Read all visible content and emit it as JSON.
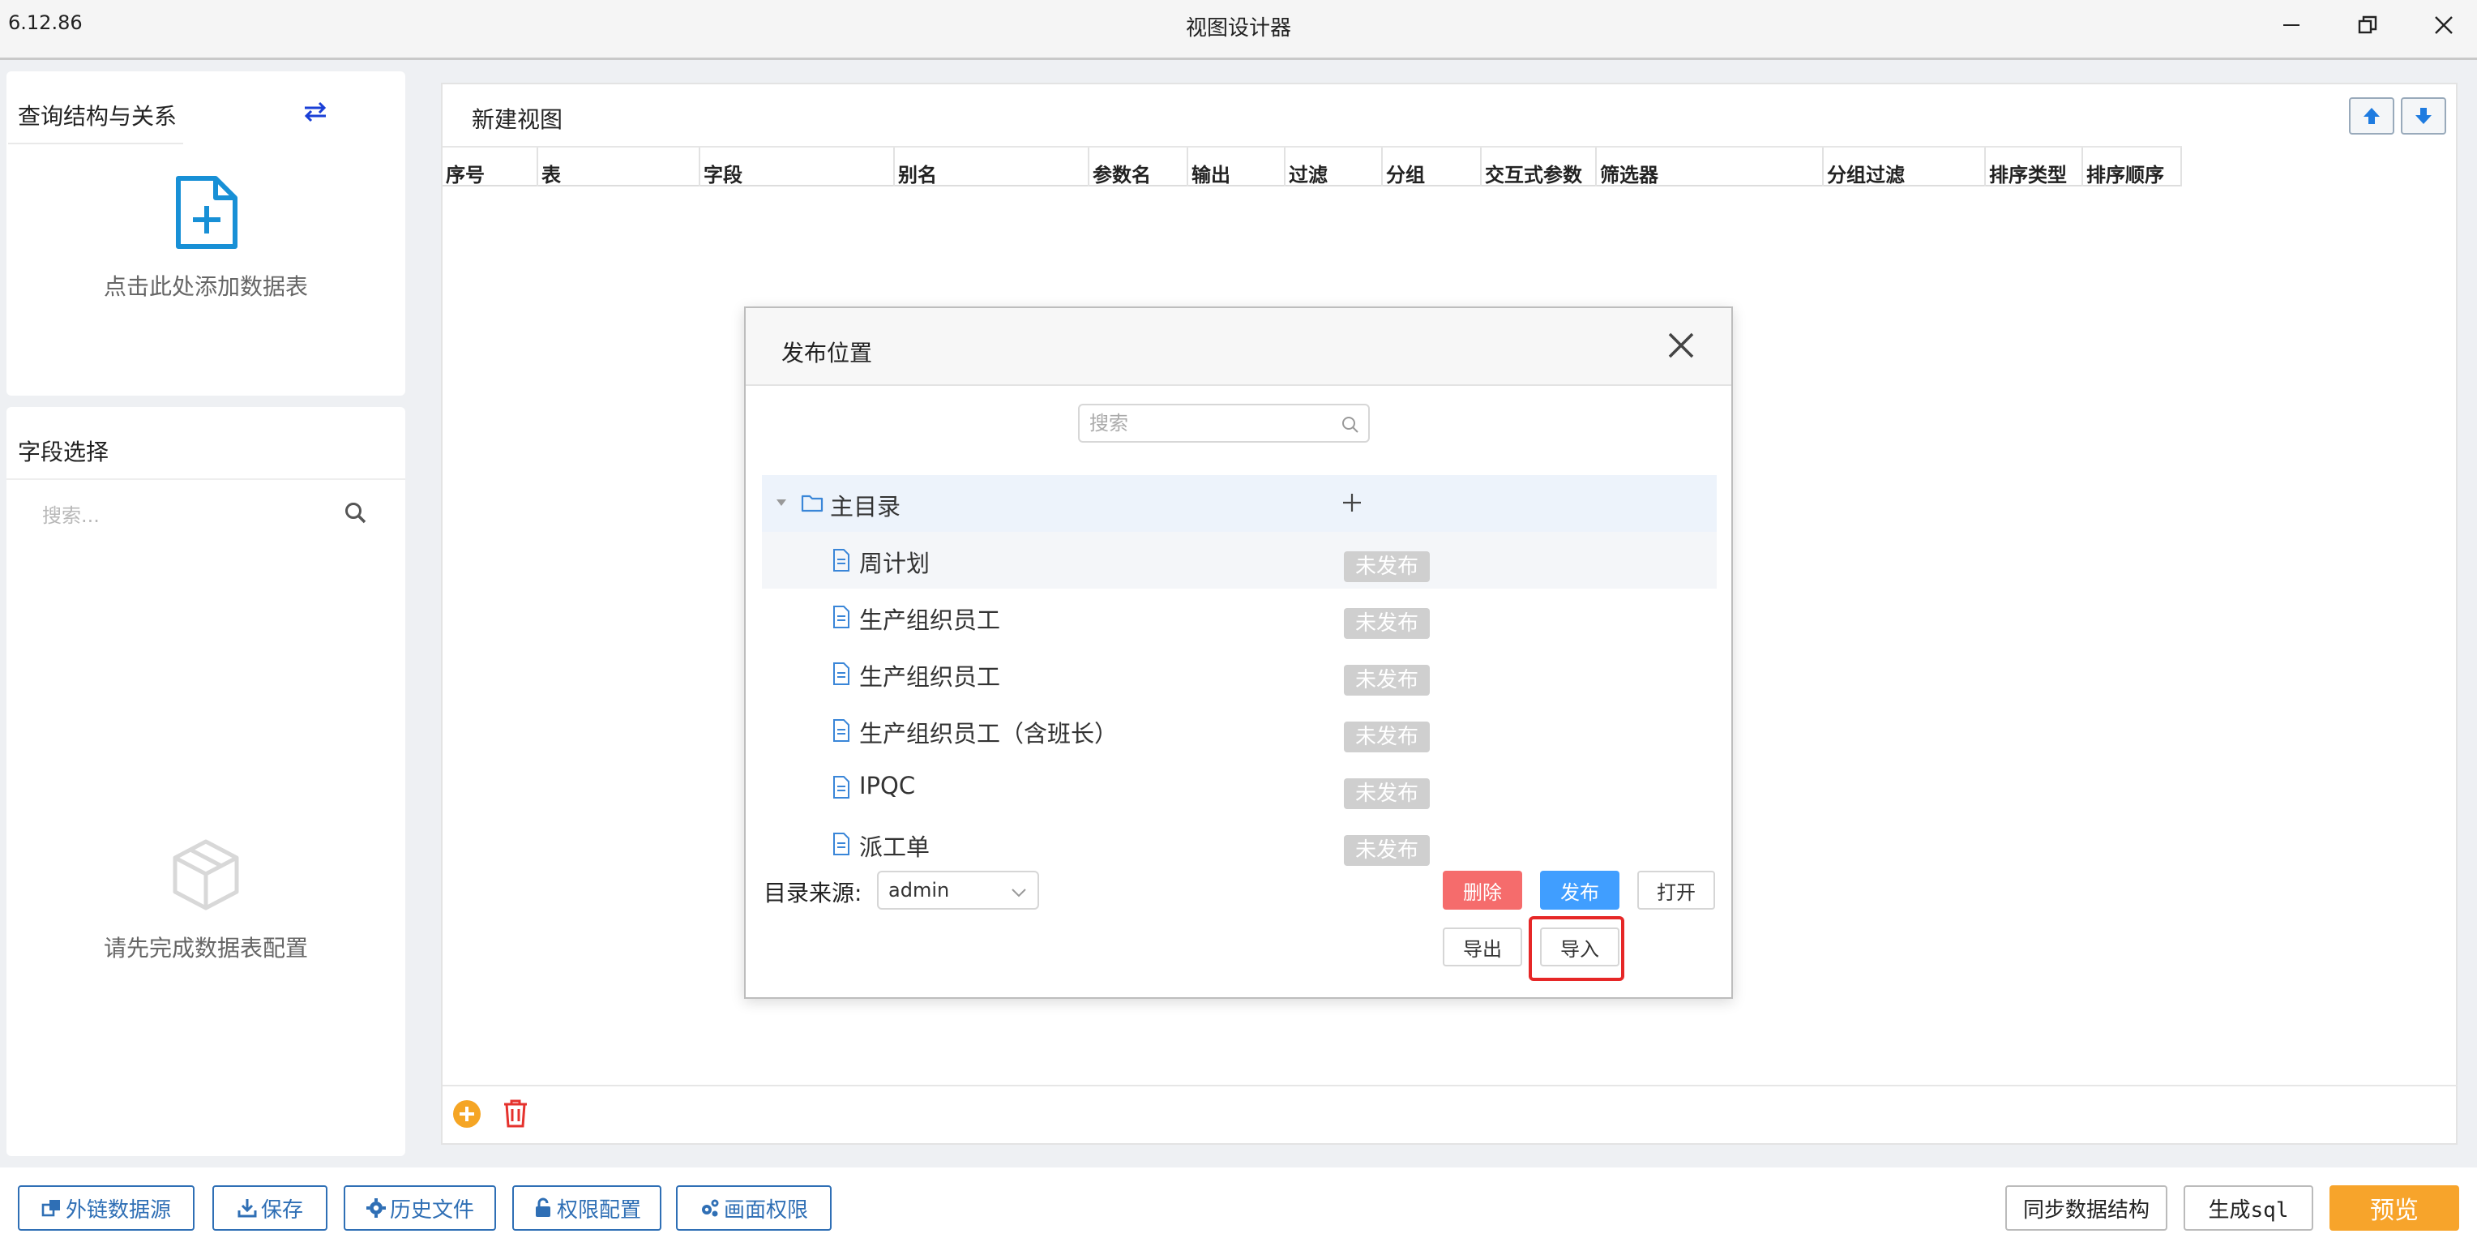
{
  "window": {
    "version": "6.12.86",
    "title": "视图设计器"
  },
  "left": {
    "query_title": "查询结构与关系",
    "add_table_hint": "点击此处添加数据表",
    "field_title": "字段选择",
    "field_search_placeholder": "搜索...",
    "empty_hint": "请先完成数据表配置"
  },
  "main": {
    "title": "新建视图",
    "columns": [
      "序号",
      "表",
      "字段",
      "别名",
      "参数名",
      "输出",
      "过滤",
      "分组",
      "交互式参数",
      "筛选器",
      "分组过滤",
      "排序类型",
      "排序顺序"
    ]
  },
  "toolbar": {
    "external_source": "外链数据源",
    "save": "保存",
    "history": "历史文件",
    "permission_config": "权限配置",
    "screen_permission": "画面权限",
    "sync_structure": "同步数据结构",
    "generate_sql": "生成sql",
    "preview": "预览"
  },
  "modal": {
    "title": "发布位置",
    "search_placeholder": "搜索",
    "root": "主目录",
    "items": [
      {
        "label": "周计划",
        "status": "未发布"
      },
      {
        "label": "生产组织员工",
        "status": "未发布"
      },
      {
        "label": "生产组织员工",
        "status": "未发布"
      },
      {
        "label": "生产组织员工（含班长）",
        "status": "未发布"
      },
      {
        "label": "IPQC",
        "status": "未发布"
      },
      {
        "label": "派工单",
        "status": "未发布"
      }
    ],
    "source_label": "目录来源:",
    "source_value": "admin",
    "buttons": {
      "delete": "删除",
      "publish": "发布",
      "open": "打开",
      "export": "导出",
      "import": "导入"
    }
  },
  "colors": {
    "primary_blue": "#2f6fb5",
    "accent_orange": "#f7a42b",
    "danger_red": "#f56c6c",
    "publish_blue": "#409eff",
    "highlight_red": "#e62727"
  }
}
